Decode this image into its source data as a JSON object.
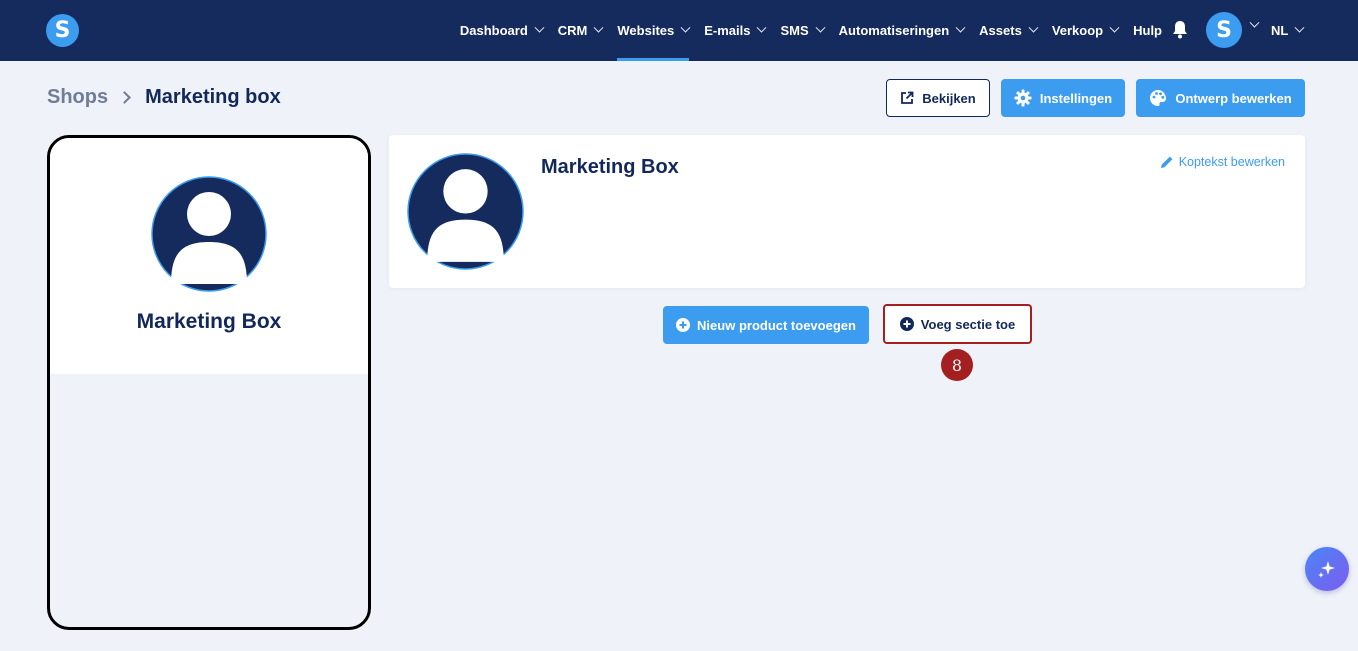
{
  "brand": {
    "logo_letter": "S",
    "colors": {
      "nav_bg": "#152a5d",
      "accent": "#3c9cf0",
      "highlight": "#a41f1f",
      "text_dark": "#13285a"
    }
  },
  "nav": {
    "items": [
      {
        "label": "Dashboard",
        "dropdown": true,
        "active": false
      },
      {
        "label": "CRM",
        "dropdown": true,
        "active": false
      },
      {
        "label": "Websites",
        "dropdown": true,
        "active": true
      },
      {
        "label": "E-mails",
        "dropdown": true,
        "active": false
      },
      {
        "label": "SMS",
        "dropdown": true,
        "active": false
      },
      {
        "label": "Automatiseringen",
        "dropdown": true,
        "active": false
      },
      {
        "label": "Assets",
        "dropdown": true,
        "active": false
      },
      {
        "label": "Verkoop",
        "dropdown": true,
        "active": false
      },
      {
        "label": "Hulp",
        "dropdown": false,
        "active": false
      }
    ],
    "notification_icon": "bell-icon",
    "user_avatar_letter": "S",
    "language": "NL"
  },
  "breadcrumb": {
    "parent": "Shops",
    "current": "Marketing box"
  },
  "header_buttons": {
    "view": {
      "label": "Bekijken",
      "icon": "external-link-icon"
    },
    "settings": {
      "label": "Instellingen",
      "icon": "gear-icon"
    },
    "design": {
      "label": "Ontwerp bewerken",
      "icon": "palette-icon"
    }
  },
  "preview": {
    "shop_name": "Marketing Box",
    "avatar_icon": "user-avatar-icon"
  },
  "shop_header": {
    "name": "Marketing Box",
    "edit_link": "Koptekst bewerken",
    "edit_icon": "pencil-icon"
  },
  "actions": {
    "new_product": {
      "label": "Nieuw product toevoegen",
      "icon": "plus-circle-icon"
    },
    "add_section": {
      "label": "Voeg sectie toe",
      "icon": "plus-circle-icon"
    }
  },
  "step_badge": "8",
  "ai_button": {
    "icon": "sparkle-icon"
  }
}
